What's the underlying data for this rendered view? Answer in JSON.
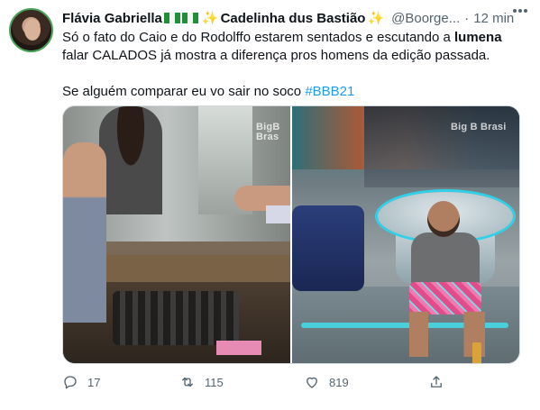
{
  "tweet": {
    "display_name": "Flávia Gabriella",
    "name_suffix": "Cadelinha dus Bastião",
    "handle": "@Boorge...",
    "separator": "·",
    "time": "12 min",
    "text_line1_a": "Só o fato do Caio e do Rodolffo estarem sentados e escutando a ",
    "text_line1_bold": "lumena",
    "text_line1_b": " falar CALADOS já mostra a diferença pros homens da edição passada.",
    "text_line2_a": "Se alguém comparar eu vo sair no soco ",
    "hashtag": "#BBB21",
    "watermark_left": "BigB Bras",
    "watermark_right": "Big B Brasi"
  },
  "actions": {
    "reply_count": "17",
    "retweet_count": "115",
    "like_count": "819"
  },
  "icons": {
    "reply": "reply-icon",
    "retweet": "retweet-icon",
    "like": "heart-icon",
    "share": "share-icon",
    "more": "more-options-icon",
    "flag": "brazil-flag-icon",
    "sparkle": "sparkles-icon"
  },
  "colors": {
    "text": "#0f1419",
    "secondary": "#536471",
    "link": "#1d9bf0",
    "border": "#cfd9de"
  }
}
